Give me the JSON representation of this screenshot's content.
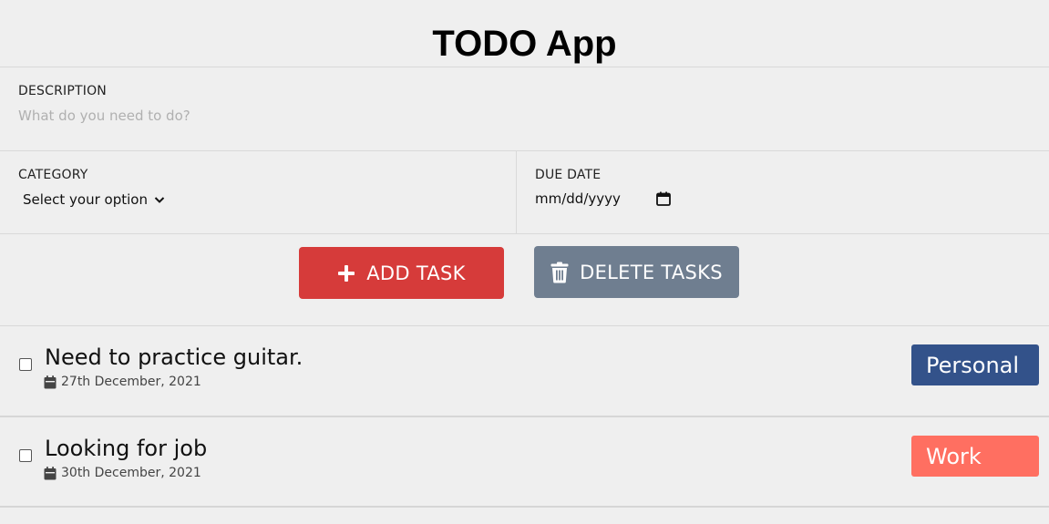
{
  "app": {
    "title": "TODO App"
  },
  "form": {
    "description": {
      "label": "DESCRIPTION",
      "placeholder": "What do you need to do?",
      "value": ""
    },
    "category": {
      "label": "CATEGORY",
      "selected": "Select your option"
    },
    "due_date": {
      "label": "DUE DATE",
      "value": "mm/dd/yyyy"
    }
  },
  "actions": {
    "add_label": "ADD TASK",
    "delete_label": "DELETE TASKS",
    "add_color": "#d63b3a",
    "delete_color": "#6f7e90"
  },
  "tasks": [
    {
      "text": "Need to practice guitar.",
      "date": "27th December, 2021",
      "category": "Personal",
      "category_color": "#33528a",
      "checked": false
    },
    {
      "text": "Looking for job",
      "date": "30th December, 2021",
      "category": "Work",
      "category_color": "#ff6f61",
      "checked": false
    }
  ],
  "icons": {
    "add": "plus-icon",
    "delete": "trash-icon",
    "category_dropdown": "chevron-down-icon",
    "date_picker": "calendar-icon",
    "task_date": "calendar-icon"
  }
}
